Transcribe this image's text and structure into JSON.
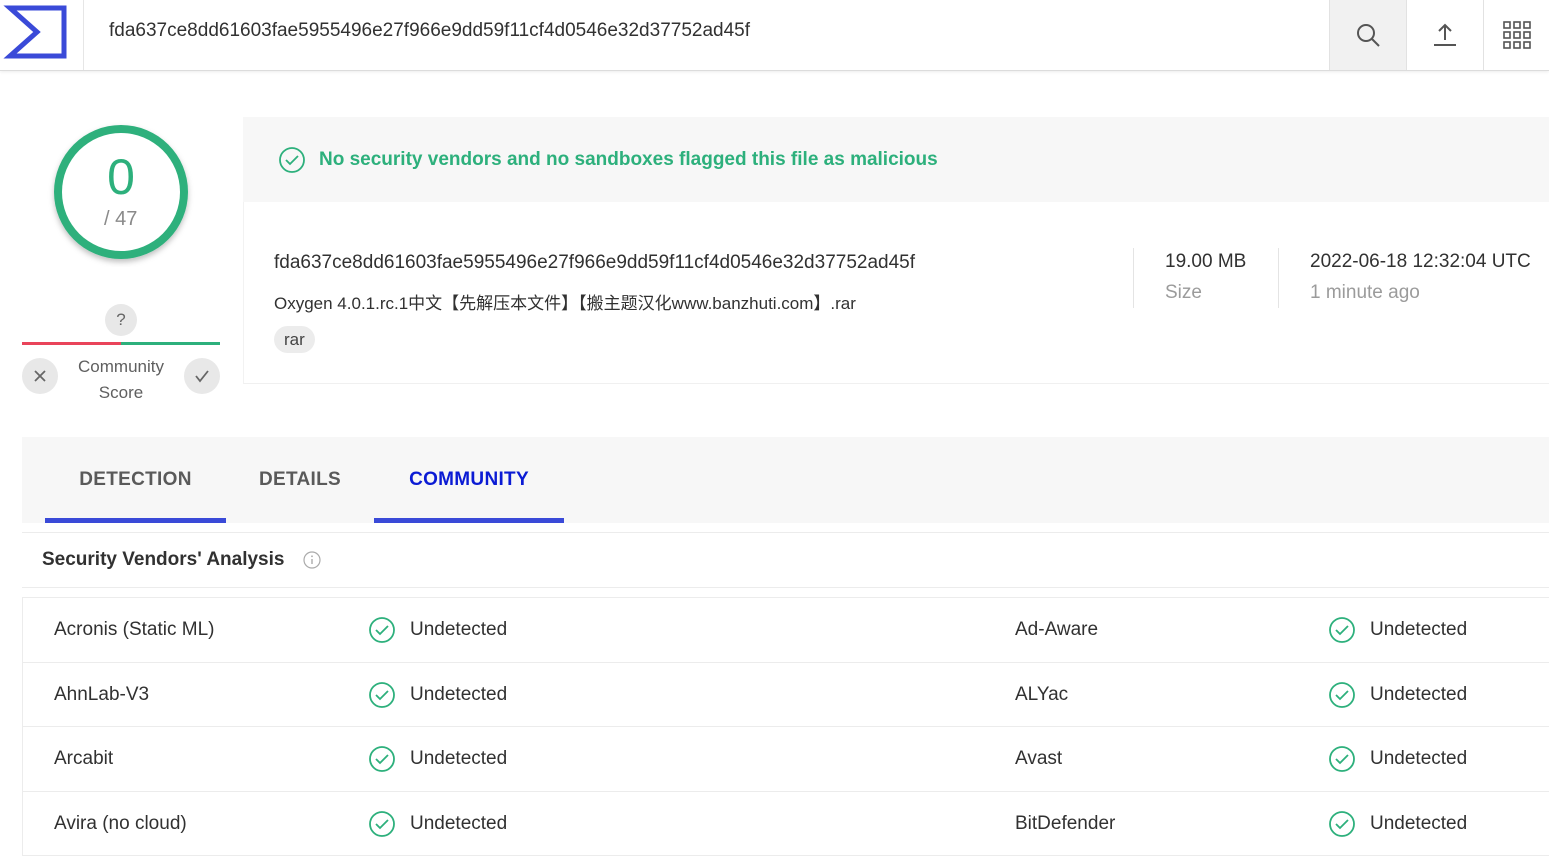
{
  "topbar": {
    "search_value": "fda637ce8dd61603fae5955496e27f966e9dd59f11cf4d0546e32d37752ad45f",
    "icons": [
      "logo-icon",
      "search-icon",
      "upload-icon",
      "apps-grid-icon"
    ]
  },
  "score": {
    "detections": "0",
    "total": "/ 47",
    "ring_color": "#2db07c",
    "community_question": "?",
    "community_label": "Community\nScore"
  },
  "verdict": {
    "text": "No security vendors and no sandboxes flagged this file as malicious",
    "color": "#2db07c"
  },
  "file": {
    "hash": "fda637ce8dd61603fae5955496e27f966e9dd59f11cf4d0546e32d37752ad45f",
    "name": "Oxygen 4.0.1.rc.1中文【先解压本文件】【搬主题汉化www.banzhuti.com】.rar",
    "tag": "rar",
    "size_value": "19.00 MB",
    "size_label": "Size",
    "date_value": "2022-06-18 12:32:04 UTC",
    "date_label": "1 minute ago"
  },
  "tabs": [
    {
      "label": "DETECTION",
      "active": false
    },
    {
      "label": "DETAILS",
      "active": false
    },
    {
      "label": "COMMUNITY",
      "active": true
    }
  ],
  "section": {
    "title": "Security Vendors' Analysis"
  },
  "vendors": [
    {
      "left_name": "Acronis (Static ML)",
      "left_result": "Undetected",
      "right_name": "Ad-Aware",
      "right_result": "Undetected"
    },
    {
      "left_name": "AhnLab-V3",
      "left_result": "Undetected",
      "right_name": "ALYac",
      "right_result": "Undetected"
    },
    {
      "left_name": "Arcabit",
      "left_result": "Undetected",
      "right_name": "Avast",
      "right_result": "Undetected"
    },
    {
      "left_name": "Avira (no cloud)",
      "left_result": "Undetected",
      "right_name": "BitDefender",
      "right_result": "Undetected"
    }
  ]
}
